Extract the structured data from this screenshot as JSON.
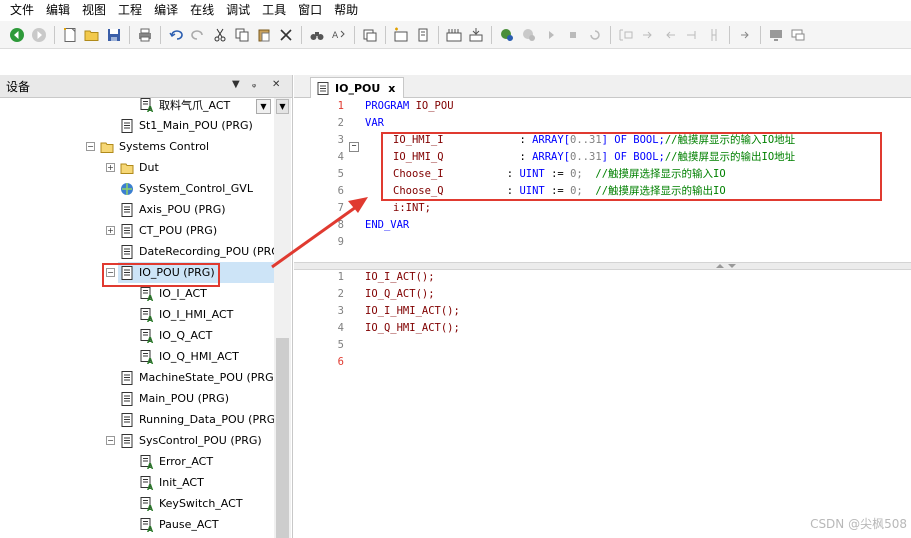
{
  "menu": [
    "文件",
    "编辑",
    "视图",
    "工程",
    "编译",
    "在线",
    "调试",
    "工具",
    "窗口",
    "帮助"
  ],
  "toolbar_icons": [
    "back-icon",
    "forward-icon",
    "new-icon",
    "open-icon",
    "save-icon",
    "print-icon",
    "undo-icon",
    "redo-icon",
    "cut-icon",
    "copy-icon",
    "paste-icon",
    "delete-icon",
    "find-icon",
    "replace-icon",
    "window-icon",
    "add-object-icon",
    "device-icon",
    "build-icon",
    "download-icon",
    "login-icon",
    "logout-icon",
    "run-icon",
    "stop-icon",
    "reset-icon",
    "breakpoint-icon",
    "step-over-icon",
    "step-into-icon",
    "step-out-icon",
    "cursor-icon",
    "more-icon",
    "screen-icon",
    "chat-icon"
  ],
  "panel": {
    "title": "设备",
    "pin": "⊕",
    "close": "✕"
  },
  "tree": [
    {
      "label": "取料气爪_ACT",
      "icon": "action"
    },
    {
      "label": "St1_Main_POU (PRG)",
      "icon": "pou"
    },
    {
      "label": "Systems Control",
      "icon": "folder",
      "expander": "−"
    },
    {
      "label": "Dut",
      "icon": "folder",
      "expander": "+"
    },
    {
      "label": "System_Control_GVL",
      "icon": "gvl"
    },
    {
      "label": "Axis_POU (PRG)",
      "icon": "pou"
    },
    {
      "label": "CT_POU (PRG)",
      "icon": "pou",
      "expander": "+"
    },
    {
      "label": "DateRecording_POU (PRG)",
      "icon": "pou"
    },
    {
      "label": "IO_POU (PRG)",
      "icon": "pou",
      "expander": "−",
      "selected": true
    },
    {
      "label": "IO_I_ACT",
      "icon": "action"
    },
    {
      "label": "IO_I_HMI_ACT",
      "icon": "action"
    },
    {
      "label": "IO_Q_ACT",
      "icon": "action"
    },
    {
      "label": "IO_Q_HMI_ACT",
      "icon": "action"
    },
    {
      "label": "MachineState_POU (PRG)",
      "icon": "pou"
    },
    {
      "label": "Main_POU (PRG)",
      "icon": "pou"
    },
    {
      "label": "Running_Data_POU (PRG)",
      "icon": "pou"
    },
    {
      "label": "SysControl_POU (PRG)",
      "icon": "pou",
      "expander": "−"
    },
    {
      "label": "Error_ACT",
      "icon": "action"
    },
    {
      "label": "Init_ACT",
      "icon": "action"
    },
    {
      "label": "KeySwitch_ACT",
      "icon": "action"
    },
    {
      "label": "Pause_ACT",
      "icon": "action"
    }
  ],
  "editor": {
    "tab_label": "IO_POU",
    "tab_close": "x",
    "decl_line_numbers": [
      "1",
      "2",
      "3",
      "4",
      "5",
      "6",
      "7",
      "8",
      "9"
    ],
    "impl_line_numbers": [
      "1",
      "2",
      "3",
      "4",
      "5",
      "6"
    ],
    "impl_code": [
      "IO_I_ACT();",
      "IO_Q_ACT();",
      "IO_I_HMI_ACT();",
      "IO_Q_HMI_ACT();",
      "",
      ""
    ]
  },
  "decl": {
    "program_kw": "PROGRAM",
    "program_name": "IO_POU",
    "var_kw": "VAR",
    "l3_name": "IO_HMI_I",
    "l3_colon": ":",
    "l3_type_a": "ARRAY[",
    "l3_range": "0..31",
    "l3_type_b": "] OF BOOL;",
    "l3_comment": "//触摸屏显示的输入IO地址",
    "l4_name": "IO_HMI_Q",
    "l4_colon": ":",
    "l4_type_a": "ARRAY[",
    "l4_range": "0..31",
    "l4_type_b": "] OF BOOL;",
    "l4_comment": "//触摸屏显示的输出IO地址",
    "l5_name": "Choose_I",
    "l5_colon": ":",
    "l5_type": "UINT",
    "l5_assign": ":=",
    "l5_val": "0;",
    "l5_comment": "//触摸屏选择显示的输入IO",
    "l6_name": "Choose_Q",
    "l6_colon": ":",
    "l6_type": "UINT",
    "l6_assign": ":=",
    "l6_val": "0;",
    "l6_comment": "//触摸屏选择显示的输出IO",
    "l7": "i:INT;",
    "end_var": "END_VAR"
  },
  "watermark": "CSDN @尖枫508",
  "colors": {
    "annotation_red": "#e03a30",
    "keyword": "#0000ff",
    "identifier": "#800000",
    "comment": "#008000"
  }
}
